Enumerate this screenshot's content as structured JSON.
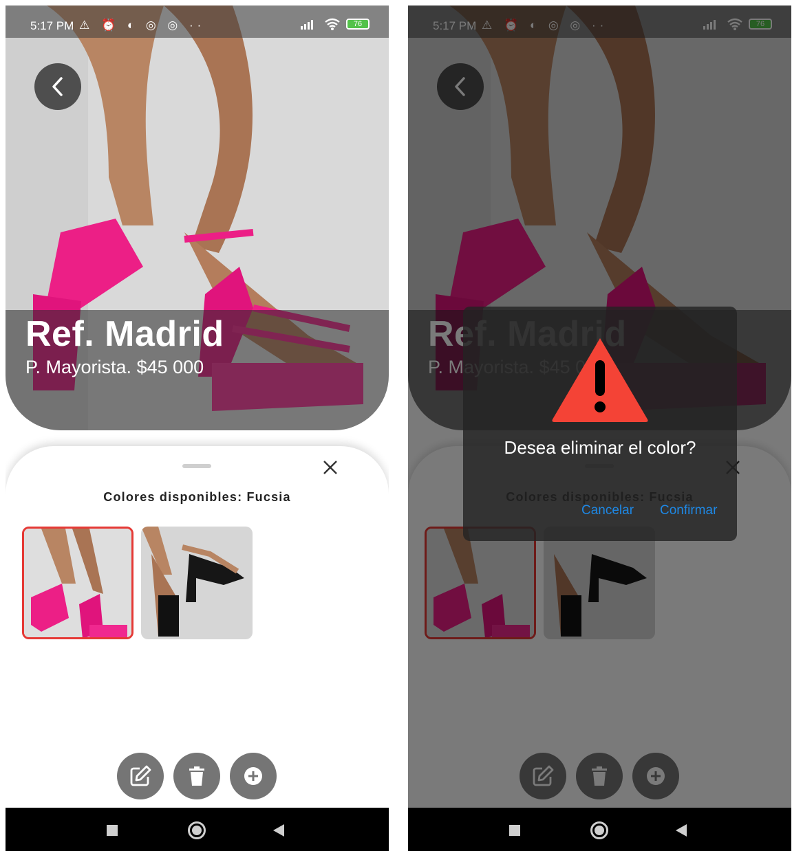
{
  "status_bar": {
    "time": "5:17 PM",
    "notification_icons": "⚠ ⏰ ◐ ◎ ◎ ··",
    "battery_level": "76"
  },
  "product": {
    "title": "Ref. Madrid",
    "price_line": "P. Mayorista. $45 000"
  },
  "sheet": {
    "colors_label": "Colores disponibles: Fucsia",
    "color_options": [
      {
        "name": "Fucsia",
        "selected": true
      },
      {
        "name": "Negro",
        "selected": false
      }
    ]
  },
  "actions": {
    "icons": [
      "edit-icon",
      "trash-icon",
      "add-circle-icon"
    ]
  },
  "dialog": {
    "title": "Desea eliminar el color?",
    "cancel_label": "Cancelar",
    "confirm_label": "Confirmar"
  },
  "colors": {
    "accent_blue": "#1e88e5",
    "selected_border": "#e53935",
    "warning_red": "#f44336",
    "product_pink": "#ec1f86"
  }
}
